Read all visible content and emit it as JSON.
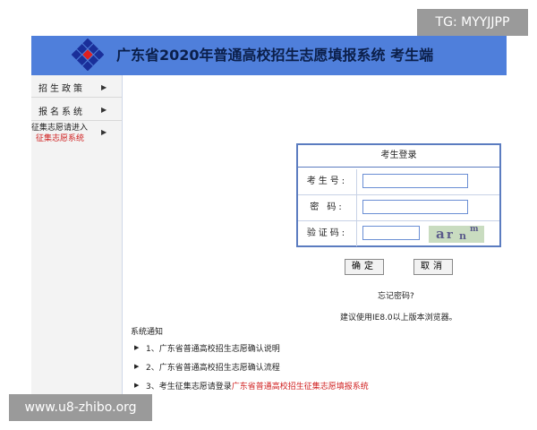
{
  "watermarks": {
    "top": "TG: MYYJJPP",
    "bottom": "www.u8-zhibo.org"
  },
  "header": {
    "title": "广东省2020年普通高校招生志愿填报系统  考生端"
  },
  "sidebar": {
    "items": [
      {
        "label": "招生政策"
      },
      {
        "label": "报名系统"
      },
      {
        "label_line1": "征集志愿请进入",
        "label_line2": "征集志愿系统"
      }
    ]
  },
  "login": {
    "heading": "考生登录",
    "fields": [
      {
        "label": "考生号:",
        "value": ""
      },
      {
        "label": "密  码:",
        "value": ""
      },
      {
        "label": "验证码:",
        "value": ""
      }
    ],
    "captcha_text": [
      "a",
      "r",
      "n",
      "m"
    ],
    "confirm_label": "确定",
    "cancel_label": "取消",
    "forgot_password": "忘记密码?",
    "browser_tip": "建议使用IE8.0以上版本浏览器。"
  },
  "notices": {
    "title": "系统通知",
    "items": [
      {
        "text": "1、广东省普通高校招生志愿确认说明",
        "link": ""
      },
      {
        "text": "2、广东省普通高校招生志愿确认流程",
        "link": ""
      },
      {
        "text": "3、考生征集志愿请登录",
        "link": "广东省普通高校招生征集志愿填报系统"
      }
    ]
  },
  "colors": {
    "header_bg": "#4f7fdb",
    "link_red": "#d02020",
    "border_blue": "#5b7cc0"
  }
}
